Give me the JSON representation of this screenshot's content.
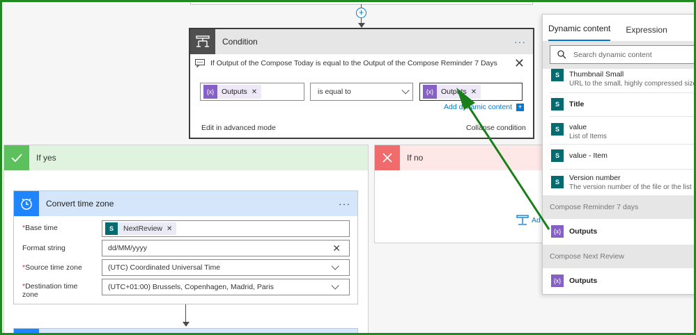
{
  "condition": {
    "title": "Condition",
    "more": "···",
    "description": "If Output of the Compose Today is equal to the Output of the Compose Reminder 7 Days",
    "left_token": "Outputs",
    "operator": "is equal to",
    "right_token": "Outputs",
    "add_dynamic": "Add dynamic content",
    "advanced_mode": "Edit in advanced mode",
    "collapse": "Collapse condition"
  },
  "if_yes": {
    "label": "If yes"
  },
  "if_no": {
    "label": "If no",
    "add_action": "Ad"
  },
  "convert_tz": {
    "title": "Convert time zone",
    "more": "···",
    "fields": [
      {
        "label": "Base time",
        "required": "*",
        "token": "NextReview"
      },
      {
        "label": "Format string",
        "value": "dd/MM/yyyy"
      },
      {
        "label": "Source time zone",
        "required": "*",
        "value": "(UTC) Coordinated Universal Time"
      },
      {
        "label": "Destination time",
        "label2": "zone",
        "required": "*",
        "value": "(UTC+01:00) Brussels, Copenhagen, Madrid, Paris"
      }
    ]
  },
  "dynamic_panel": {
    "tabs": [
      "Dynamic content",
      "Expression"
    ],
    "search_placeholder": "Search dynamic content",
    "items": [
      {
        "name": "Thumbnail Small",
        "desc": "URL to the small, highly compressed size t"
      },
      {
        "name": "Title",
        "desc": ""
      },
      {
        "name": "value",
        "desc": "List of Items"
      },
      {
        "name": "value - Item",
        "desc": ""
      },
      {
        "name": "Version number",
        "desc": "The version number of the file or the list it"
      }
    ],
    "groups": [
      {
        "title": "Compose Reminder 7 days",
        "output": "Outputs"
      },
      {
        "title": "Compose Next Review",
        "output": "Outputs"
      }
    ]
  },
  "colors": {
    "annotation_arrow": "#1a7f1a",
    "accent": "#0078d4",
    "compose": "#8661c5",
    "sharepoint": "#036c70"
  }
}
